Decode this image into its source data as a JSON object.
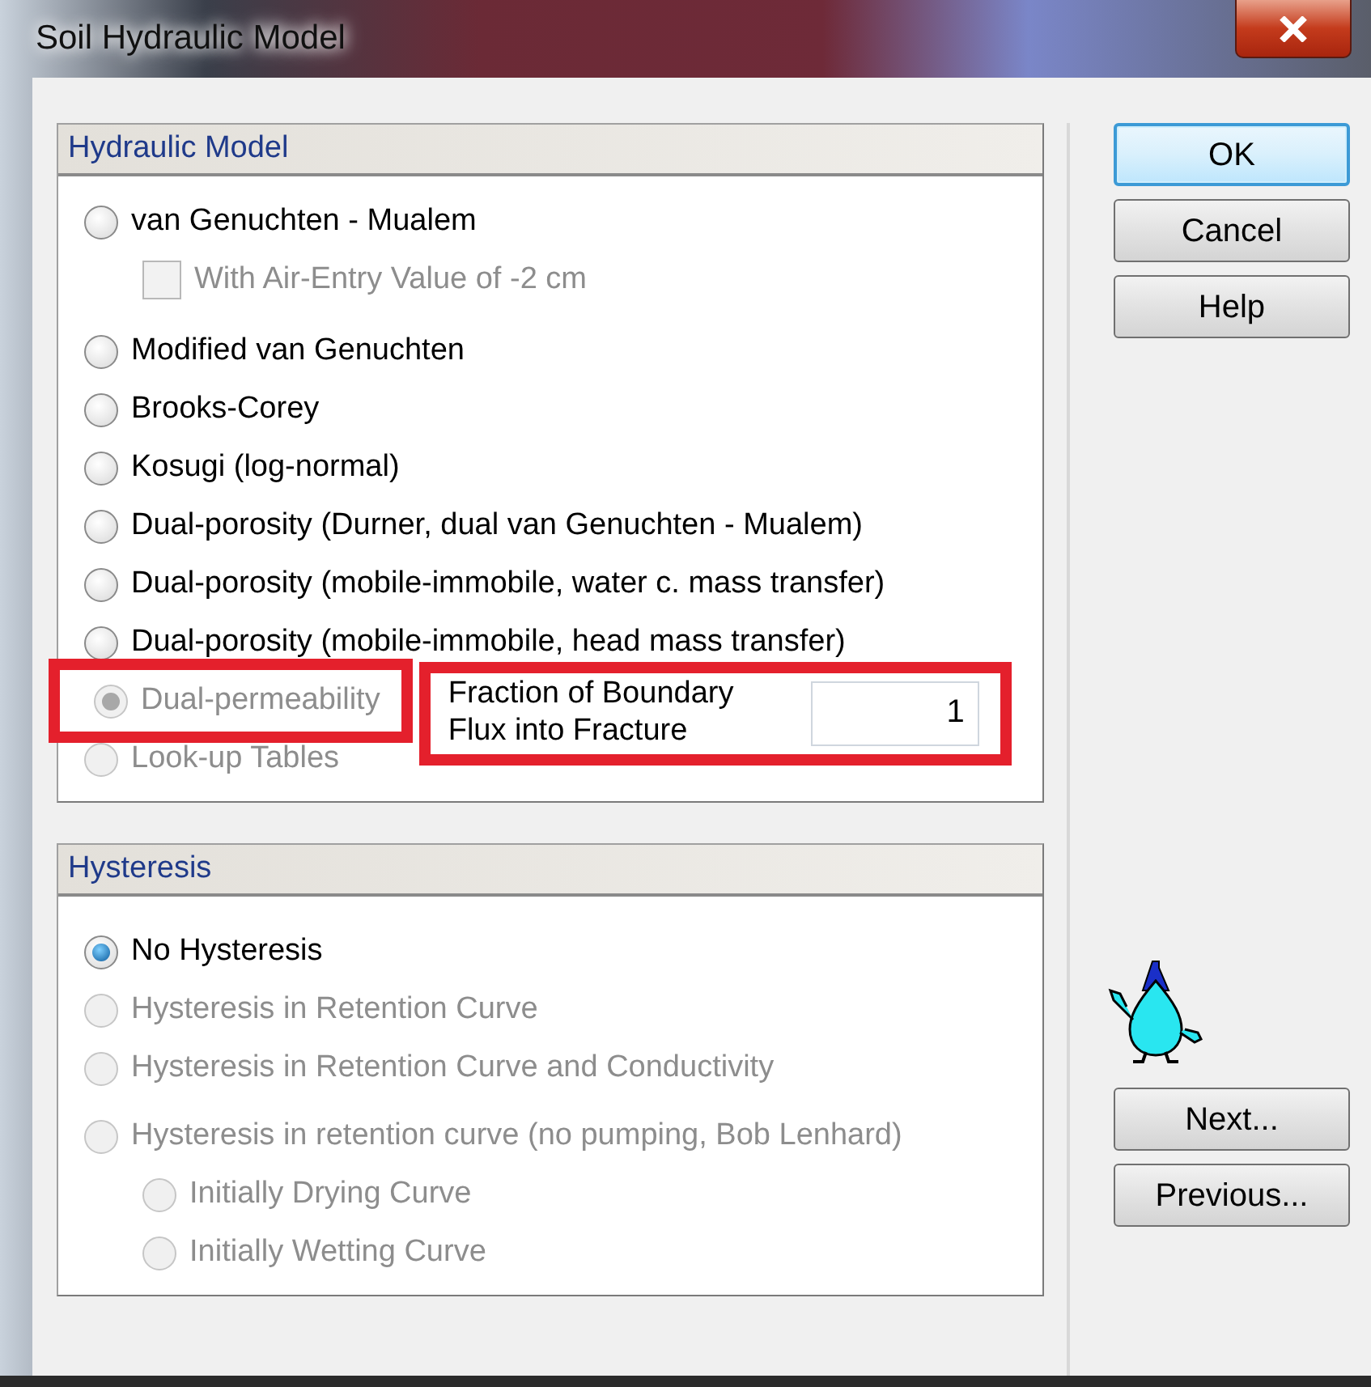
{
  "window": {
    "title": "Soil Hydraulic Model"
  },
  "hydraulic_model": {
    "title": "Hydraulic Model",
    "options": [
      {
        "label": "van Genuchten - Mualem",
        "selected": false,
        "disabled": false,
        "highlighted": false,
        "children": [
          {
            "kind": "checkbox",
            "label": "With Air-Entry Value of -2 cm",
            "checked": false,
            "disabled": true
          }
        ]
      },
      {
        "label": "Modified van Genuchten",
        "selected": false,
        "disabled": false,
        "highlighted": false
      },
      {
        "label": "Brooks-Corey",
        "selected": false,
        "disabled": false,
        "highlighted": false
      },
      {
        "label": "Kosugi (log-normal)",
        "selected": false,
        "disabled": false,
        "highlighted": false
      },
      {
        "label": "Dual-porosity (Durner, dual van Genuchten - Mualem)",
        "selected": false,
        "disabled": false,
        "highlighted": false
      },
      {
        "label": "Dual-porosity (mobile-immobile, water c. mass transfer)",
        "selected": false,
        "disabled": false,
        "highlighted": false
      },
      {
        "label": "Dual-porosity (mobile-immobile, head mass transfer)",
        "selected": false,
        "disabled": false,
        "highlighted": false
      },
      {
        "label": "Dual-permeability",
        "selected": true,
        "disabled": true,
        "highlighted": true
      },
      {
        "label": "Look-up Tables",
        "selected": false,
        "disabled": true,
        "highlighted": false
      }
    ],
    "fraction_field": {
      "label": "Fraction of Boundary Flux into Fracture",
      "value": "1",
      "highlighted": true
    }
  },
  "hysteresis": {
    "title": "Hysteresis",
    "options": [
      {
        "label": "No Hysteresis",
        "selected": true,
        "disabled": false
      },
      {
        "label": "Hysteresis in Retention Curve",
        "selected": false,
        "disabled": true
      },
      {
        "label": "Hysteresis in Retention Curve and Conductivity",
        "selected": false,
        "disabled": true
      },
      {
        "label": "Hysteresis in retention curve  (no pumping, Bob Lenhard)",
        "selected": false,
        "disabled": true,
        "children": [
          {
            "label": "Initially Drying Curve",
            "selected": false,
            "disabled": true
          },
          {
            "label": "Initially Wetting Curve",
            "selected": false,
            "disabled": true
          }
        ]
      }
    ]
  },
  "top_buttons": [
    {
      "label": "OK",
      "default": true
    },
    {
      "label": "Cancel",
      "default": false
    },
    {
      "label": "Help",
      "default": false
    }
  ],
  "bottom_buttons": [
    {
      "label": "Next...",
      "default": false
    },
    {
      "label": "Previous...",
      "default": false
    }
  ]
}
